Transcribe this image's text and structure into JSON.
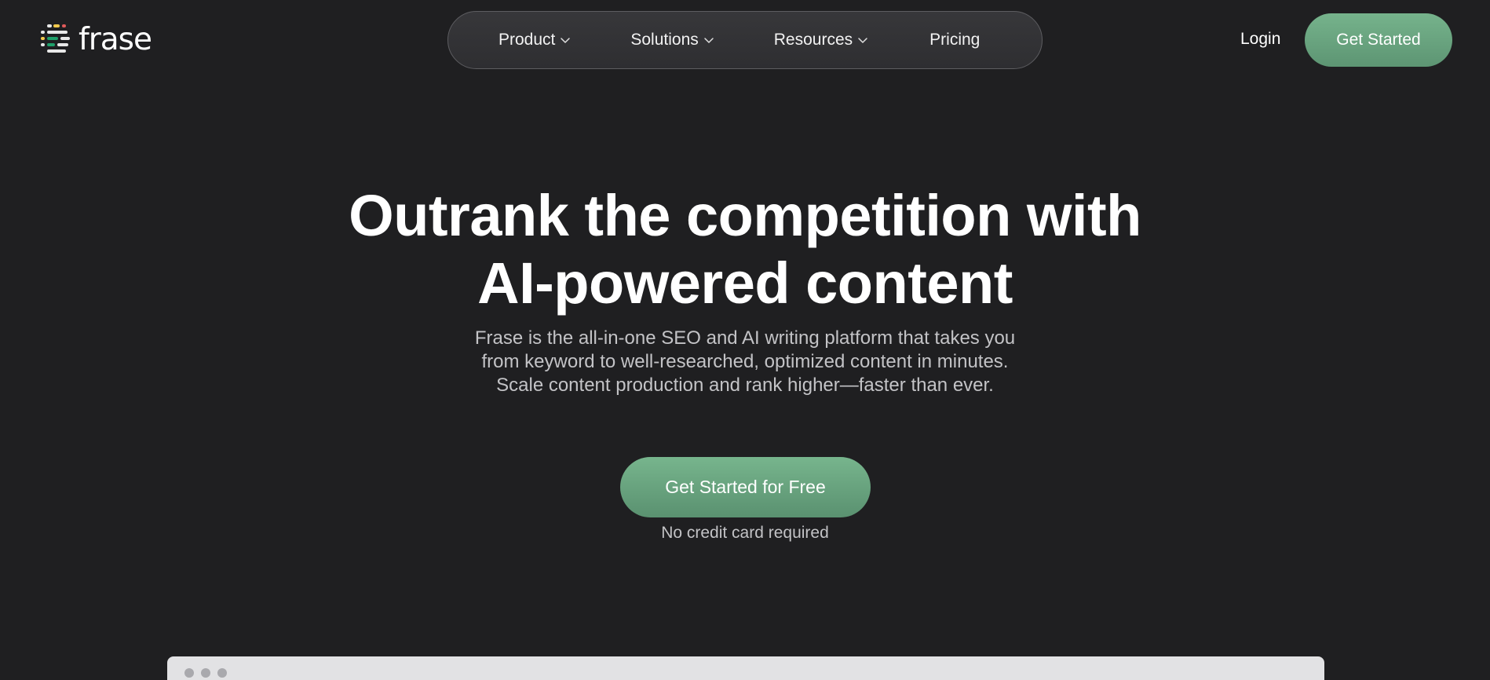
{
  "brand": {
    "name": "frase",
    "logo_icon": "frase-logo-icon"
  },
  "nav": {
    "items": [
      {
        "label": "Product",
        "icon": "chevron-down-icon"
      },
      {
        "label": "Solutions",
        "icon": "chevron-down-icon"
      },
      {
        "label": "Resources",
        "icon": "chevron-down-icon"
      },
      {
        "label": "Pricing"
      }
    ]
  },
  "header": {
    "login_label": "Login",
    "cta_label": "Get Started"
  },
  "hero": {
    "title_line1": "Outrank the competition with",
    "title_line2": "AI-powered content",
    "subtitle_line1": "Frase is the all-in-one SEO and AI writing platform that takes you",
    "subtitle_line2": "from keyword to well-researched, optimized content in minutes.",
    "subtitle_line3": "Scale content production and rank higher—faster than ever.",
    "cta_label": "Get Started for Free",
    "note": "No credit card required"
  },
  "colors": {
    "background": "#1f1f21",
    "accent_green": "#6aa680",
    "nav_pill": "#333336",
    "muted_text": "#c3c3c6"
  }
}
